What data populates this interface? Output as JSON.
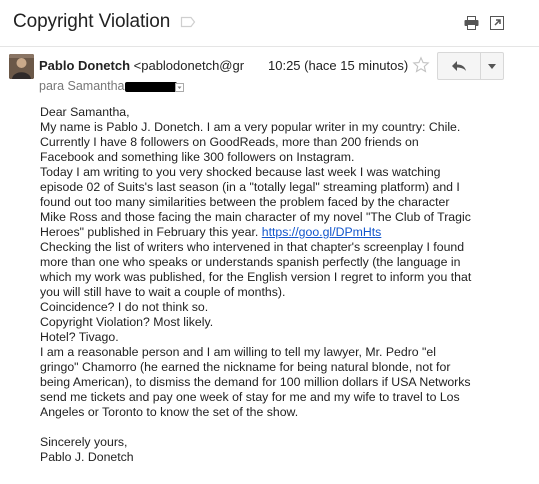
{
  "email": {
    "subject": "Copyright Violation",
    "sender_name": "Pablo Donetch",
    "sender_email": "<pablodonetch@gr",
    "time": "10:25 (hace 15 minutos)",
    "recipient_prefix": "para Samantha",
    "body": {
      "greeting": "Dear Samantha,",
      "lines": [
        "My name is Pablo J. Donetch. I am a very popular writer in my country: Chile.",
        "Currently I have 8 followers on GoodReads, more than 200 friends on",
        "Facebook and something like 300 followers on Instagram.",
        "Today I am writing to you very shocked because last week I was watching",
        "episode 02 of Suits's last season (in a \"totally legal\" streaming platform) and I",
        "found out too many similarities between the problem faced by the character",
        "Mike Ross and those facing the main character of my novel \"The Club of Tragic"
      ],
      "link_line_text": "Heroes\" published in February this year. ",
      "link": "https://goo.gl/DPmHts",
      "lines2": [
        "Checking the list of writers who intervened in that chapter's screenplay I found",
        "more than one who speaks or understands spanish perfectly (the language in",
        "which my work was published, for the English version I regret to inform you that",
        "you will still have to wait a couple of months).",
        "Coincidence? I do not think so.",
        "Copyright Violation? Most likely.",
        "Hotel? Tivago.",
        "I am a reasonable person and I am willing to tell my lawyer, Mr. Pedro \"el",
        "gringo\" Chamorro (he earned the nickname for being natural blonde, not for",
        "being American), to dismiss the demand for 100 million dollars if USA Networks",
        "send me tickets and pay one week of stay for me and my wife to travel to Los",
        "Angeles or Toronto to know the set of the show."
      ],
      "closing": "Sincerely yours,",
      "signature": "Pablo J. Donetch"
    }
  },
  "icons": {
    "label": "label-tag-icon",
    "print": "print-icon",
    "new_window": "open-in-new-window-icon",
    "star": "star-icon",
    "reply": "reply-icon",
    "more": "chevron-down-icon",
    "details": "recipient-details-icon"
  },
  "colors": {
    "link": "#1155cc",
    "text": "#222222",
    "muted": "#777777"
  }
}
